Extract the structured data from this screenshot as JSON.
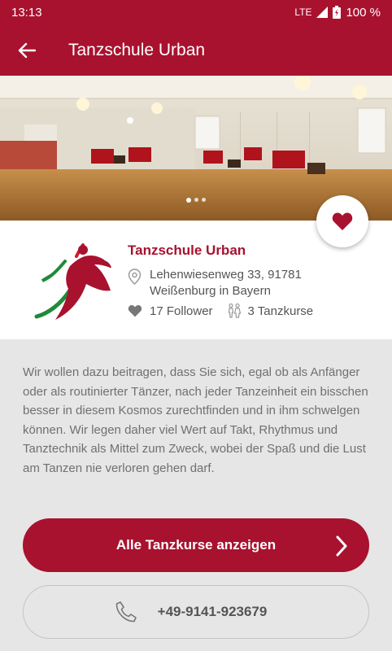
{
  "status_bar": {
    "time": "13:13",
    "network": "LTE",
    "battery": "100 %"
  },
  "header": {
    "title": "Tanzschule Urban"
  },
  "school": {
    "name": "Tanzschule Urban",
    "address_line1": "Lehenwiesenweg 33, 91781",
    "address_line2": "Weißenburg in Bayern",
    "followers": "17 Follower",
    "courses": "3 Tanzkurse"
  },
  "description": "Wir wollen dazu beitragen, dass Sie sich, egal ob als Anfänger oder als routinierter Tänzer, nach jeder Tanzeinheit ein bisschen besser in diesem Kosmos zurechtfinden und in ihm schwelgen können. Wir legen daher viel Wert auf Takt, Rhythmus und Tanztechnik als Mittel zum Zweck, wobei der Spaß und die Lust am Tanzen nie verloren gehen darf.",
  "buttons": {
    "all_courses": "Alle Tanzkurse anzeigen",
    "phone": "+49-9141-923679"
  },
  "colors": {
    "brand": "#a8122f",
    "background": "#e6e6e6"
  },
  "icons": [
    "back-arrow-icon",
    "heart-icon",
    "location-pin-icon",
    "couple-icon",
    "chevron-right-icon",
    "phone-icon"
  ]
}
